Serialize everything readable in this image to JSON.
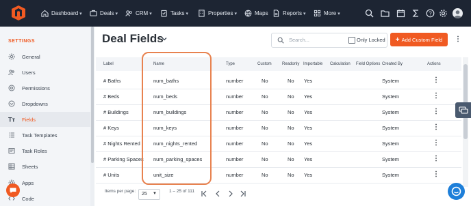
{
  "nav": {
    "items": [
      {
        "label": "Dashboard",
        "icon": "home-icon"
      },
      {
        "label": "Deals",
        "icon": "deals-icon"
      },
      {
        "label": "CRM",
        "icon": "crm-icon"
      },
      {
        "label": "Tasks",
        "icon": "tasks-icon"
      },
      {
        "label": "Properties",
        "icon": "properties-icon"
      },
      {
        "label": "Maps",
        "icon": "maps-icon"
      },
      {
        "label": "Reports",
        "icon": "reports-icon"
      },
      {
        "label": "More",
        "icon": "more-icon"
      }
    ]
  },
  "sidebar": {
    "section_title": "SETTINGS",
    "items": [
      {
        "label": "General"
      },
      {
        "label": "Users"
      },
      {
        "label": "Permissions"
      },
      {
        "label": "Dropdowns"
      },
      {
        "label": "Fields"
      },
      {
        "label": "Task Templates"
      },
      {
        "label": "Task Roles"
      },
      {
        "label": "Sheets"
      },
      {
        "label": "Apps"
      },
      {
        "label": "Code"
      }
    ],
    "active": "Fields"
  },
  "page": {
    "title": "Deal Fields",
    "search_placeholder": "Search...",
    "only_locked_label": "Only Locked",
    "add_button_label": "Add Custom Field"
  },
  "table": {
    "headers": [
      "Label",
      "Name",
      "Type",
      "Custom",
      "Readonly",
      "Importable",
      "Calculation",
      "Field Options",
      "Created By",
      "Actions"
    ],
    "rows": [
      {
        "label": "# Baths",
        "name": "num_baths",
        "type": "number",
        "custom": "No",
        "readonly": "No",
        "importable": "Yes",
        "created_by": "System"
      },
      {
        "label": "# Beds",
        "name": "num_beds",
        "type": "number",
        "custom": "No",
        "readonly": "No",
        "importable": "Yes",
        "created_by": "System"
      },
      {
        "label": "# Buildings",
        "name": "num_buildings",
        "type": "number",
        "custom": "No",
        "readonly": "No",
        "importable": "Yes",
        "created_by": "System"
      },
      {
        "label": "# Keys",
        "name": "num_keys",
        "type": "number",
        "custom": "No",
        "readonly": "No",
        "importable": "Yes",
        "created_by": "System"
      },
      {
        "label": "# Nights Rented",
        "name": "num_nights_rented",
        "type": "number",
        "custom": "No",
        "readonly": "No",
        "importable": "Yes",
        "created_by": "System"
      },
      {
        "label": "# Parking Spaces",
        "name": "num_parking_spaces",
        "type": "number",
        "custom": "No",
        "readonly": "No",
        "importable": "Yes",
        "created_by": "System"
      },
      {
        "label": "# Units",
        "name": "unit_size",
        "type": "number",
        "custom": "No",
        "readonly": "No",
        "importable": "Yes",
        "created_by": "System"
      }
    ]
  },
  "pagination": {
    "items_per_page_label": "Items per page:",
    "items_per_page_value": "25",
    "range_text": "1 – 25 of 111"
  },
  "colors": {
    "brand": "#f05a22",
    "nav_bg": "#1d2533",
    "highlight": "#e8824f"
  }
}
